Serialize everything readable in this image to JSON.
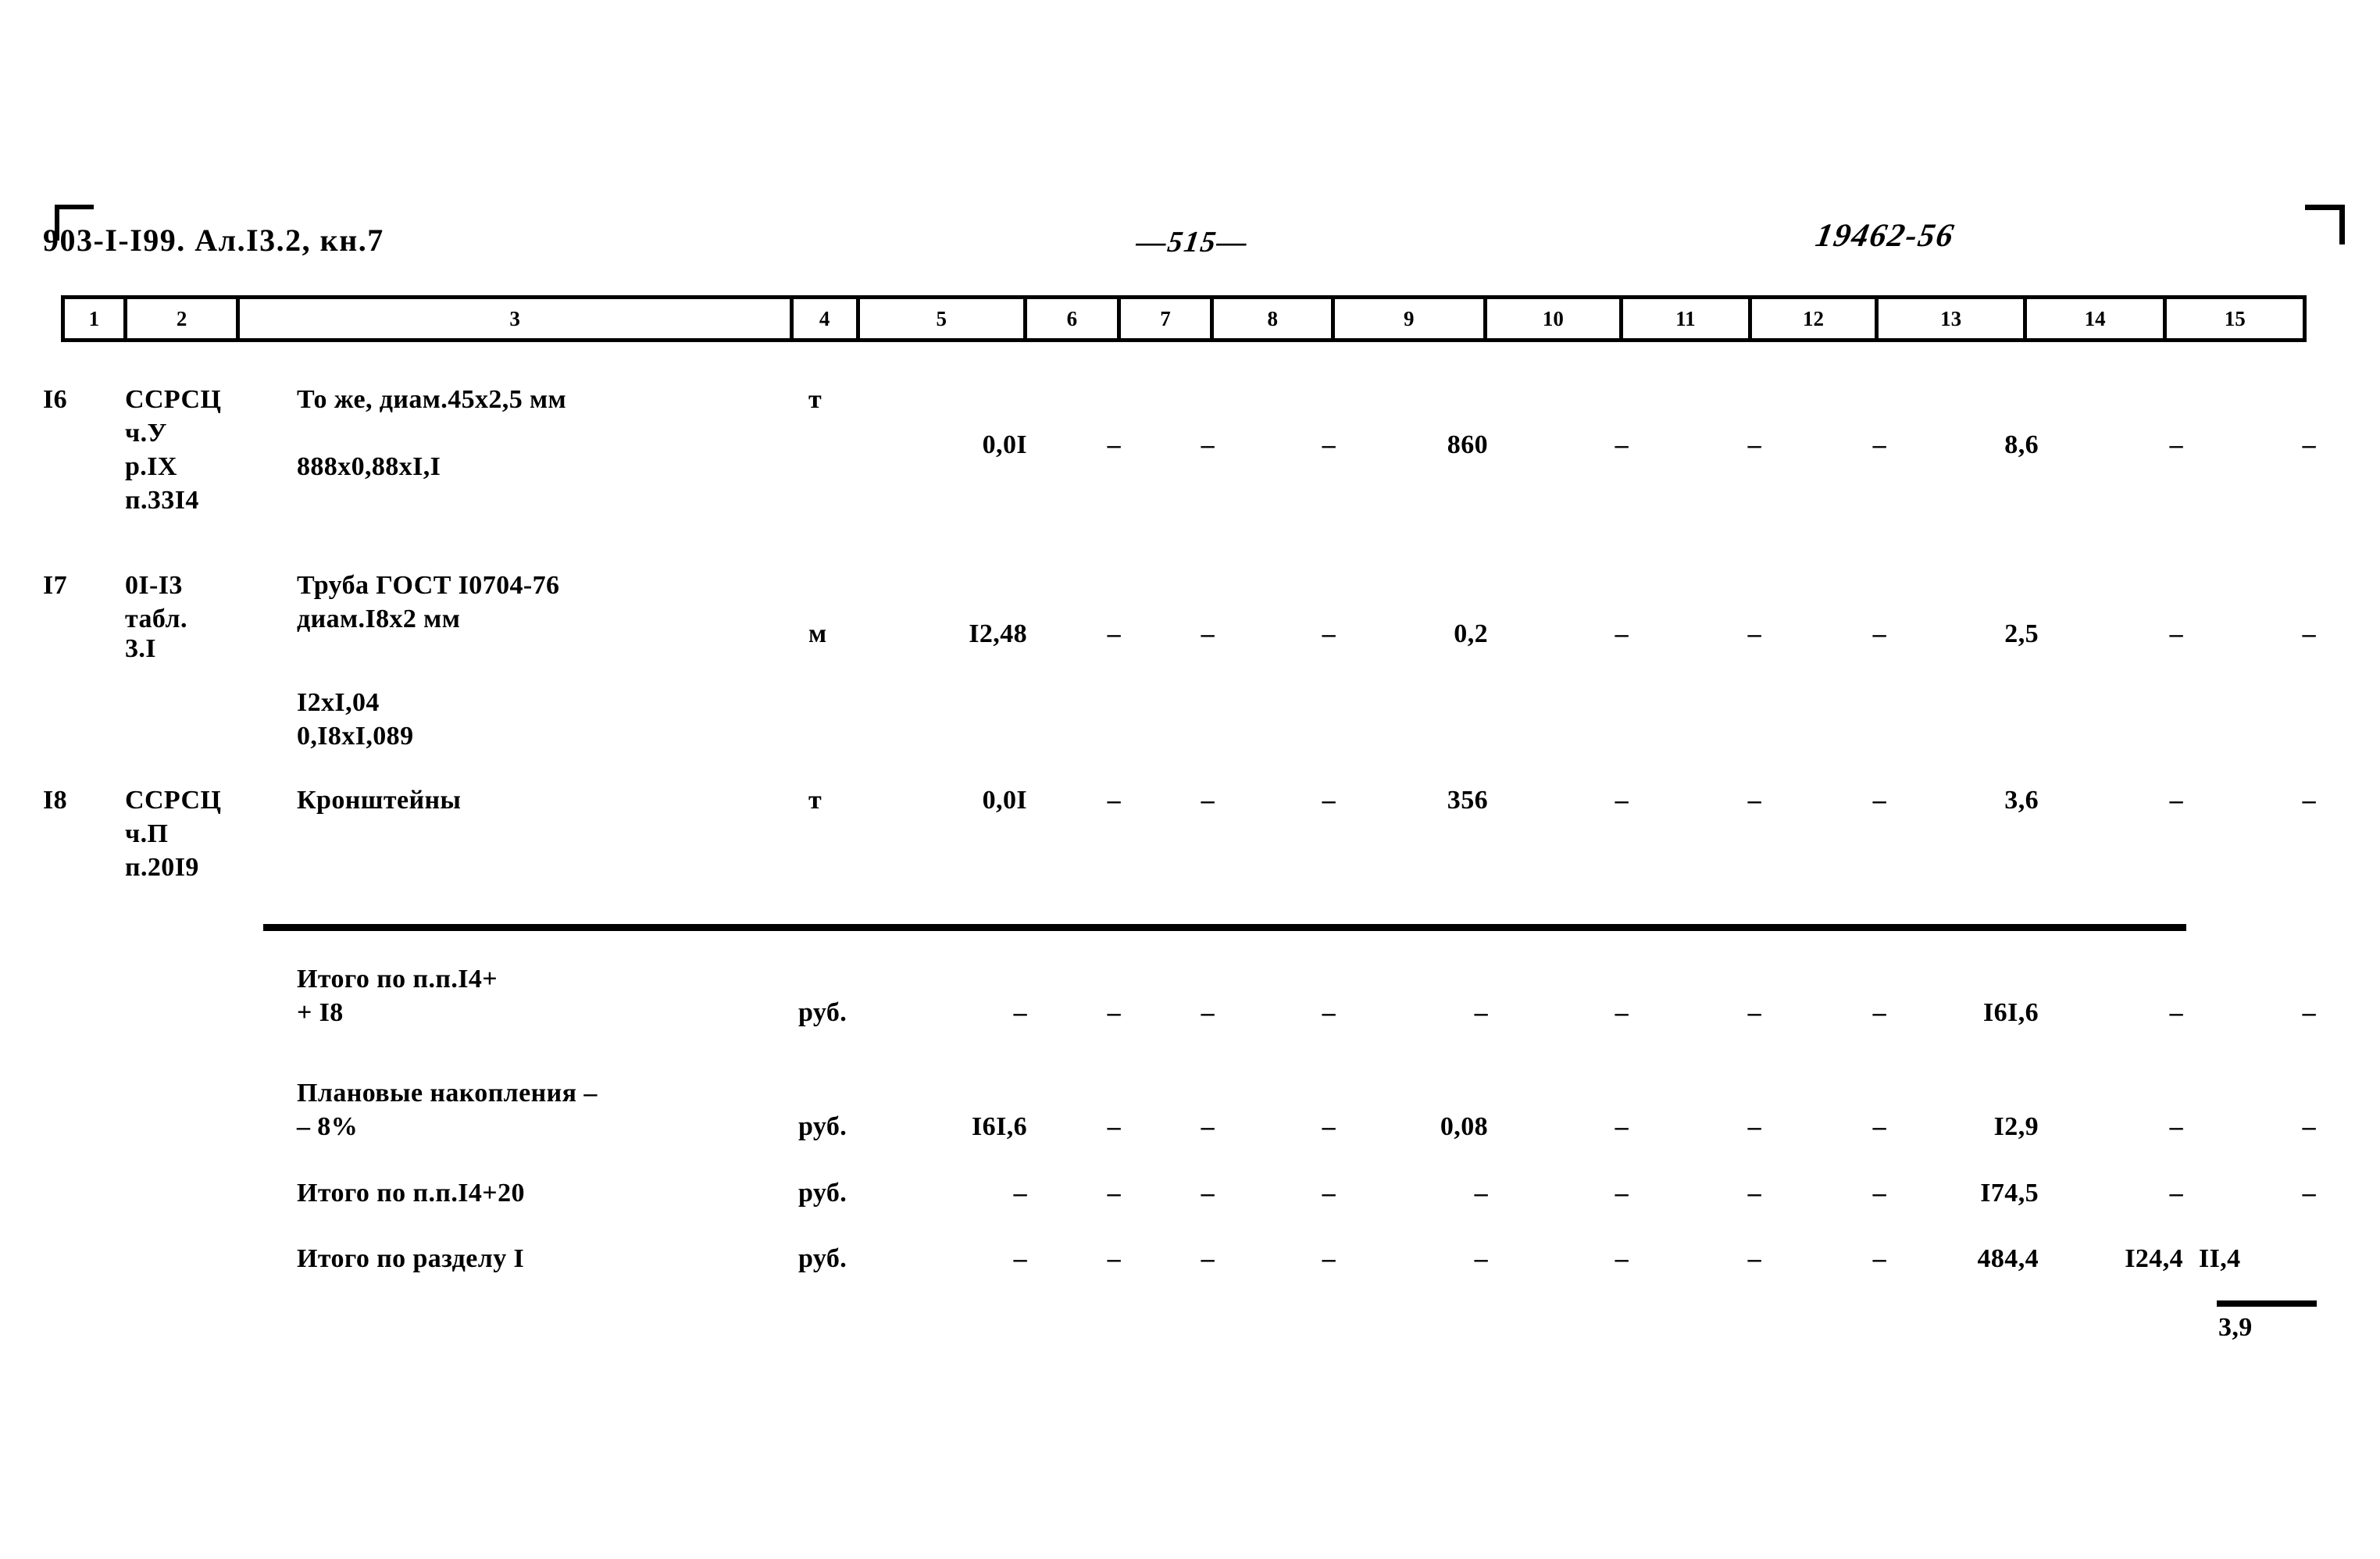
{
  "document": {
    "header_left": "903-I-I99. Ал.I3.2, кн.7",
    "header_center": "—515—",
    "header_right": "19462-56"
  },
  "table": {
    "column_numbers": [
      "1",
      "2",
      "3",
      "4",
      "5",
      "6",
      "7",
      "8",
      "9",
      "10",
      "11",
      "12",
      "13",
      "14",
      "15"
    ],
    "rows": [
      {
        "num": "I6",
        "code_lines": [
          "ССРСЦ",
          "ч.У",
          "р.IХ",
          "п.33I4"
        ],
        "desc_lines": [
          "То же, диам.45х2,5 мм",
          "888х0,88хI,I"
        ],
        "unit": "т",
        "c5": "0,0I",
        "c6": "–",
        "c7": "–",
        "c8": "–",
        "c9": "860",
        "c10": "–",
        "c11": "–",
        "c12": "–",
        "c13": "8,6",
        "c14": "–",
        "c15": "–"
      },
      {
        "num": "I7",
        "code_lines": [
          "0I-I3",
          "табл.",
          "3.I"
        ],
        "desc_lines": [
          "Труба ГОСТ I0704-76",
          "диам.I8х2 мм",
          "I2хI,04",
          "0,I8хI,089"
        ],
        "unit": "м",
        "c5": "I2,48",
        "c6": "–",
        "c7": "–",
        "c8": "–",
        "c9": "0,2",
        "c10": "–",
        "c11": "–",
        "c12": "–",
        "c13": "2,5",
        "c14": "–",
        "c15": "–"
      },
      {
        "num": "I8",
        "code_lines": [
          "ССРСЦ",
          "ч.П",
          "п.20I9"
        ],
        "desc_lines": [
          "Кронштейны"
        ],
        "unit": "т",
        "c5": "0,0I",
        "c6": "–",
        "c7": "–",
        "c8": "–",
        "c9": "356",
        "c10": "–",
        "c11": "–",
        "c12": "–",
        "c13": "3,6",
        "c14": "–",
        "c15": "–"
      }
    ],
    "summary_rows": [
      {
        "label_lines": [
          "Итого по п.п.I4+",
          "+ I8"
        ],
        "unit": "руб.",
        "c5": "–",
        "c6": "–",
        "c7": "–",
        "c8": "–",
        "c9": "–",
        "c10": "–",
        "c11": "–",
        "c12": "–",
        "c13": "I6I,6",
        "c14": "–",
        "c15": "–"
      },
      {
        "label_lines": [
          "Плановые накопления –",
          "– 8%"
        ],
        "unit": "руб.",
        "c5": "I6I,6",
        "c6": "–",
        "c7": "–",
        "c8": "–",
        "c9": "0,08",
        "c10": "–",
        "c11": "–",
        "c12": "–",
        "c13": "I2,9",
        "c14": "–",
        "c15": "–"
      },
      {
        "label_lines": [
          "Итого по п.п.I4+20"
        ],
        "unit": "руб.",
        "c5": "–",
        "c6": "–",
        "c7": "–",
        "c8": "–",
        "c9": "–",
        "c10": "–",
        "c11": "–",
        "c12": "–",
        "c13": "I74,5",
        "c14": "–",
        "c15": "–"
      },
      {
        "label_lines": [
          "Итого по разделу I"
        ],
        "unit": "руб.",
        "c5": "–",
        "c6": "–",
        "c7": "–",
        "c8": "–",
        "c9": "–",
        "c10": "–",
        "c11": "–",
        "c12": "–",
        "c13": "484,4",
        "c14": "I24,4",
        "c15": "II,4",
        "c15_denominator": "3,9"
      }
    ]
  }
}
